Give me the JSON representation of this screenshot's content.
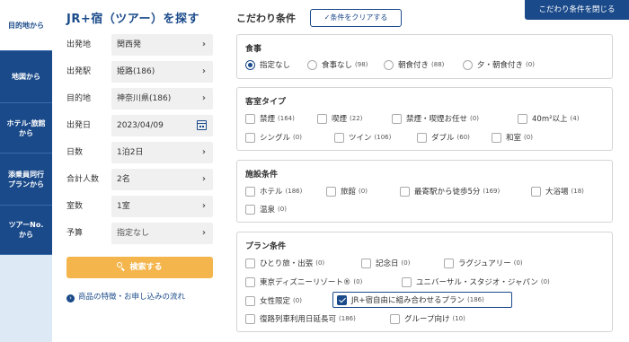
{
  "sidebar": {
    "tabs": [
      {
        "label": "目的地から"
      },
      {
        "label": "地図から"
      },
      {
        "label": "ホテル·旅館\nから"
      },
      {
        "label": "添乗員同行\nプランから"
      },
      {
        "label": "ツアーNo.\nから"
      }
    ]
  },
  "form": {
    "title": "JR+宿（ツアー）を探す",
    "fields": [
      {
        "label": "出発地",
        "value": "関西発"
      },
      {
        "label": "出発駅",
        "value": "姫路(186)"
      },
      {
        "label": "目的地",
        "value": "神奈川県(186)"
      },
      {
        "label": "出発日",
        "value": "2023/04/09"
      },
      {
        "label": "日数",
        "value": "1泊2日"
      },
      {
        "label": "合計人数",
        "value": "2名"
      },
      {
        "label": "室数",
        "value": "1室"
      },
      {
        "label": "予算",
        "value": "指定なし"
      }
    ],
    "search_label": "検索する",
    "features_link": "商品の特徴・お申し込みの流れ"
  },
  "conditions": {
    "title": "こだわり条件",
    "clear_label": "✓条件をクリアする",
    "close_label": "こだわり条件を閉じる",
    "meal": {
      "title": "食事",
      "options": [
        {
          "label": "指定なし",
          "count": "",
          "selected": true
        },
        {
          "label": "食事なし",
          "count": "(98)"
        },
        {
          "label": "朝食付き",
          "count": "(88)"
        },
        {
          "label": "夕・朝食付き",
          "count": "(0)"
        }
      ]
    },
    "room": {
      "title": "客室タイプ",
      "options": [
        {
          "label": "禁煙",
          "count": "(164)"
        },
        {
          "label": "喫煙",
          "count": "(22)"
        },
        {
          "label": "禁煙・喫煙お任せ",
          "count": "(0)"
        },
        {
          "label": "40m²以上",
          "count": "(4)"
        },
        {
          "label": "シングル",
          "count": "(0)"
        },
        {
          "label": "ツイン",
          "count": "(106)"
        },
        {
          "label": "ダブル",
          "count": "(60)"
        },
        {
          "label": "和室",
          "count": "(0)"
        }
      ]
    },
    "facility": {
      "title": "施設条件",
      "options": [
        {
          "label": "ホテル",
          "count": "(186)"
        },
        {
          "label": "旅館",
          "count": "(0)"
        },
        {
          "label": "最寄駅から徒歩5分",
          "count": "(169)"
        },
        {
          "label": "大浴場",
          "count": "(18)"
        },
        {
          "label": "温泉",
          "count": "(0)"
        }
      ]
    },
    "plan": {
      "title": "プラン条件",
      "options": [
        {
          "label": "ひとり旅・出張",
          "count": "(0)"
        },
        {
          "label": "記念日",
          "count": "(0)"
        },
        {
          "label": "ラグジュアリー",
          "count": "(0)"
        },
        {
          "label": "東京ディズニーリゾート®",
          "count": "(0)"
        },
        {
          "label": "ユニバーサル・スタジオ・ジャパン",
          "count": "(0)"
        },
        {
          "label": "女性限定",
          "count": "(0)"
        },
        {
          "label": "JR+宿自由に組み合わせるプラン",
          "count": "(186)",
          "checked": true
        },
        {
          "label": "復路列車利用日延長可",
          "count": "(186)"
        },
        {
          "label": "グループ向け",
          "count": "(10)"
        }
      ]
    }
  }
}
